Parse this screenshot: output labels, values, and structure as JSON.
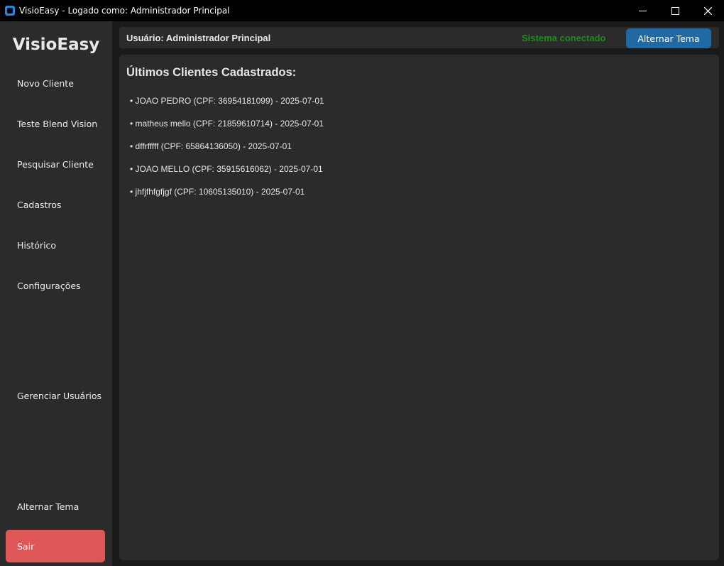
{
  "window": {
    "title": "VisioEasy - Logado como: Administrador Principal",
    "controls": [
      "minimize-icon",
      "maximize-icon",
      "close-icon"
    ]
  },
  "sidebar": {
    "brand": "VisioEasy",
    "items": [
      {
        "label": "Novo Cliente"
      },
      {
        "label": "Teste Blend Vision"
      },
      {
        "label": "Pesquisar Cliente"
      },
      {
        "label": "Cadastros"
      },
      {
        "label": "Histórico"
      },
      {
        "label": "Configurações"
      },
      {
        "label": "Gerenciar Usuários"
      },
      {
        "label": "Alternar Tema"
      }
    ],
    "logout_label": "Sair"
  },
  "header": {
    "user_label": "Usuário: Administrador Principal",
    "status": "Sistema conectado",
    "theme_button": "Alternar Tema"
  },
  "main": {
    "title": "Últimos Clientes Cadastrados:",
    "clients": [
      "• JOAO PEDRO (CPF: 36954181099) - 2025-07-01",
      "• matheus mello (CPF: 21859610714) - 2025-07-01",
      "• dffrfffff (CPF: 65864136050) - 2025-07-01",
      "• JOAO MELLO (CPF: 35915616062) - 2025-07-01",
      "• jhfjfhfgfjgf (CPF: 10605135010) - 2025-07-01"
    ]
  },
  "colors": {
    "accent": "#1f6aa5",
    "danger": "#de5656",
    "success": "#1a8f1a",
    "panel": "#2b2b2b",
    "background": "#1a1a1a"
  }
}
